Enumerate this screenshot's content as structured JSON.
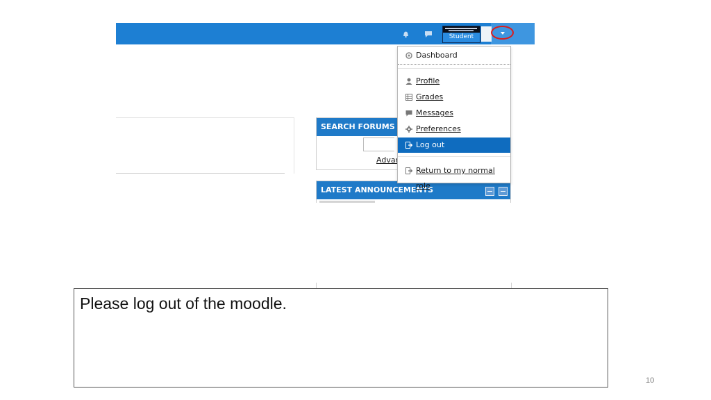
{
  "header": {
    "user_name": "Student",
    "colors": {
      "bar": "#1d7fd3",
      "highlight_circle": "#d81e1e"
    }
  },
  "user_menu": {
    "items": [
      {
        "label": "Dashboard",
        "icon": "dashboard-icon",
        "underlined": false,
        "active": false
      },
      {
        "label": "Profile",
        "icon": "person-icon",
        "underlined": true,
        "active": false
      },
      {
        "label": "Grades",
        "icon": "grades-table-icon",
        "underlined": true,
        "active": false
      },
      {
        "label": "Messages",
        "icon": "chat-icon",
        "underlined": true,
        "active": false
      },
      {
        "label": "Preferences",
        "icon": "gear-icon",
        "underlined": true,
        "active": false
      },
      {
        "label": "Log out",
        "icon": "logout-icon",
        "underlined": false,
        "active": true
      },
      {
        "label": "Return to my normal role",
        "icon": "logout-icon",
        "underlined": true,
        "active": false
      }
    ],
    "active_color": "#0f6cbf"
  },
  "blocks": {
    "search_forums": {
      "title": "SEARCH FORUMS",
      "advanced_link": "Advan"
    },
    "latest_announcements": {
      "title": "LATEST ANNOUNCEMENTS"
    }
  },
  "slide": {
    "instruction": "Please log out of the moodle.",
    "page_number": "10"
  }
}
